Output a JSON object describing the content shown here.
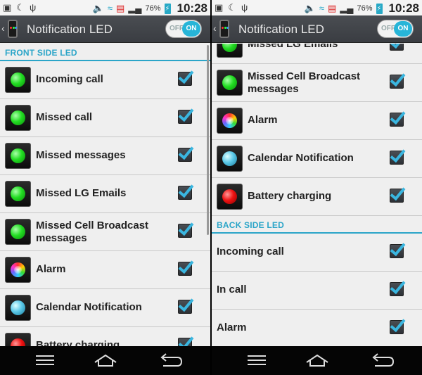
{
  "status_bar": {
    "battery": "76%",
    "time": "10:28",
    "icons_left": [
      "image-icon",
      "night-icon",
      "usb-icon"
    ],
    "icons_right": [
      "mute-icon",
      "wifi-icon",
      "sim-icon",
      "signal-icon"
    ]
  },
  "action_bar": {
    "title": "Notification LED",
    "toggle_off_label": "OFF",
    "toggle_on_label": "ON"
  },
  "left_panel": {
    "section_header": "FRONT SIDE LED",
    "items": [
      {
        "label": "Incoming call",
        "led": "green",
        "checked": true
      },
      {
        "label": "Missed call",
        "led": "green",
        "checked": true
      },
      {
        "label": "Missed messages",
        "led": "green",
        "checked": true
      },
      {
        "label": "Missed LG Emails",
        "led": "green",
        "checked": true
      },
      {
        "label": "Missed Cell Broadcast messages",
        "led": "green",
        "checked": true
      },
      {
        "label": "Alarm",
        "led": "multi",
        "checked": true
      },
      {
        "label": "Calendar Notification",
        "led": "blue",
        "checked": true
      },
      {
        "label": "Battery charging",
        "led": "red",
        "checked": true
      }
    ]
  },
  "right_panel": {
    "top_items": [
      {
        "label": "Missed LG Emails",
        "led": "green",
        "checked": true
      },
      {
        "label": "Missed Cell Broadcast messages",
        "led": "green",
        "checked": true
      },
      {
        "label": "Alarm",
        "led": "multi",
        "checked": true
      },
      {
        "label": "Calendar Notification",
        "led": "blue",
        "checked": true
      },
      {
        "label": "Battery charging",
        "led": "red",
        "checked": true
      }
    ],
    "section_header": "BACK SIDE LED",
    "back_items": [
      {
        "label": "Incoming call",
        "checked": true
      },
      {
        "label": "In call",
        "checked": true
      },
      {
        "label": "Alarm",
        "checked": true
      }
    ]
  },
  "colors": {
    "accent": "#2ba5c8",
    "toggle_on": "#27b5d8",
    "action_bar": "#43464b"
  }
}
